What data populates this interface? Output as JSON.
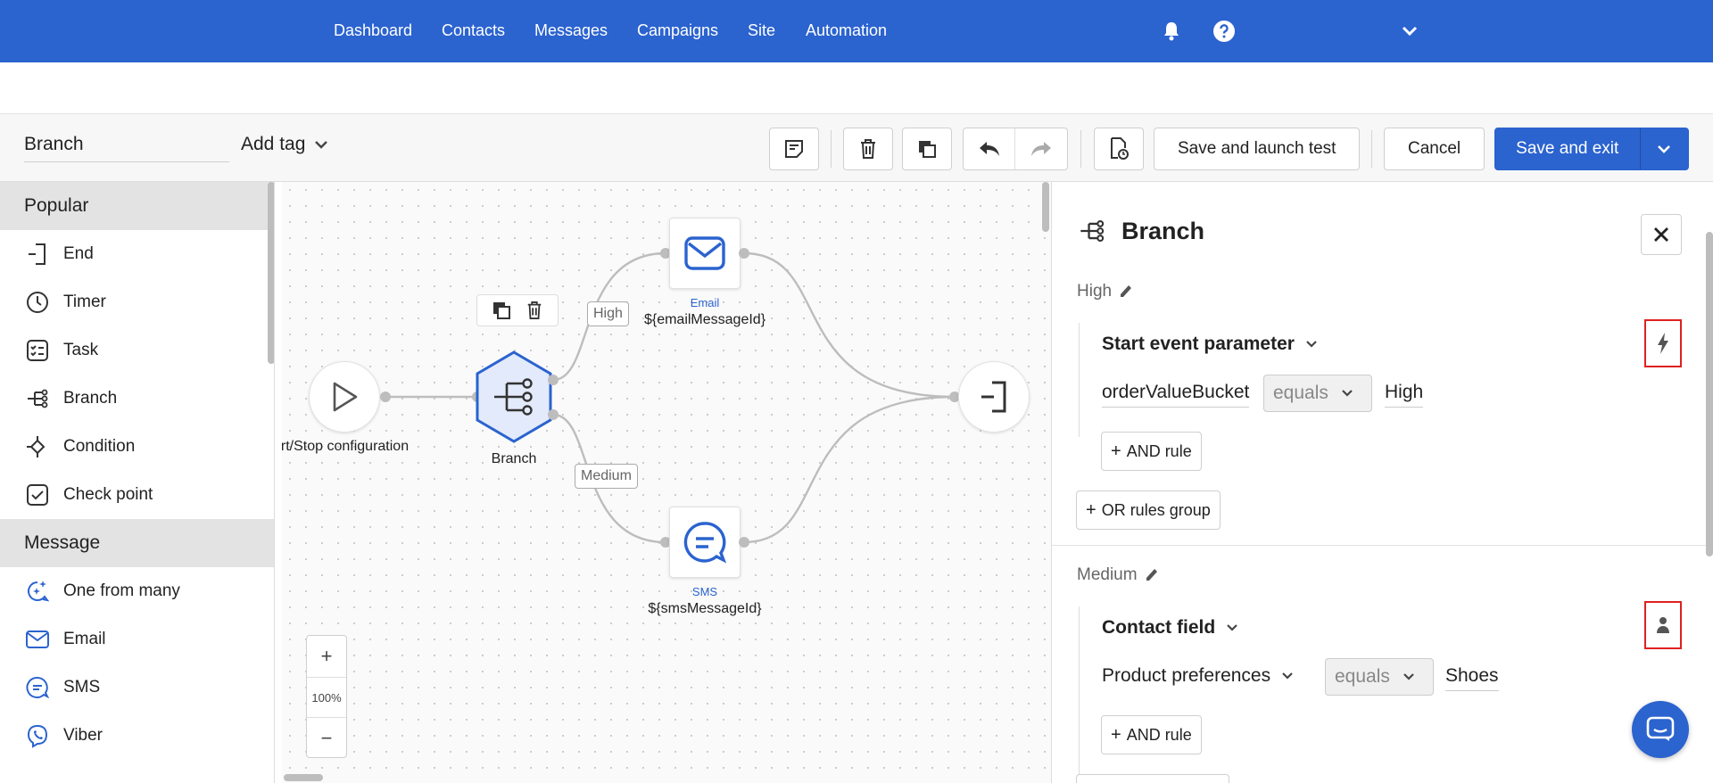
{
  "nav": {
    "items": [
      "Dashboard",
      "Contacts",
      "Messages",
      "Campaigns",
      "Site",
      "Automation"
    ],
    "brand_color": "#2b63cf"
  },
  "toolbar": {
    "flow_name": "Branch",
    "add_tag": "Add tag",
    "save_test": "Save and launch test",
    "cancel": "Cancel",
    "save_exit": "Save and exit"
  },
  "palette": {
    "sections": [
      {
        "title": "Popular",
        "items": [
          {
            "label": "End",
            "icon": "end-icon"
          },
          {
            "label": "Timer",
            "icon": "timer-icon"
          },
          {
            "label": "Task",
            "icon": "task-icon"
          },
          {
            "label": "Branch",
            "icon": "branch-icon"
          },
          {
            "label": "Condition",
            "icon": "condition-icon"
          },
          {
            "label": "Check point",
            "icon": "checkpoint-icon"
          }
        ]
      },
      {
        "title": "Message",
        "items": [
          {
            "label": "One from many",
            "icon": "sparkle-message-icon"
          },
          {
            "label": "Email",
            "icon": "email-icon"
          },
          {
            "label": "SMS",
            "icon": "sms-icon"
          },
          {
            "label": "Viber",
            "icon": "viber-icon"
          }
        ]
      }
    ]
  },
  "canvas": {
    "start_label": "art/Stop configuration",
    "branch_label": "Branch",
    "email_type": "Email",
    "email_label": "${emailMessageId}",
    "sms_type": "SMS",
    "sms_label": "${smsMessageId}",
    "edge_high": "High",
    "edge_medium": "Medium",
    "zoom_level": "100%",
    "zoom_in": "+",
    "zoom_out": "−"
  },
  "panel": {
    "title": "Branch",
    "groups": [
      {
        "name": "High",
        "rule_title": "Start event parameter",
        "field": "orderValueBucket",
        "operator": "equals",
        "value": "High",
        "and_rule": "AND rule",
        "or_group": "OR rules group",
        "source_icon": "lightning-icon"
      },
      {
        "name": "Medium",
        "rule_title": "Contact field",
        "field": "Product preferences",
        "operator": "equals",
        "value": "Shoes",
        "and_rule": "AND rule",
        "source_icon": "person-icon"
      }
    ]
  }
}
